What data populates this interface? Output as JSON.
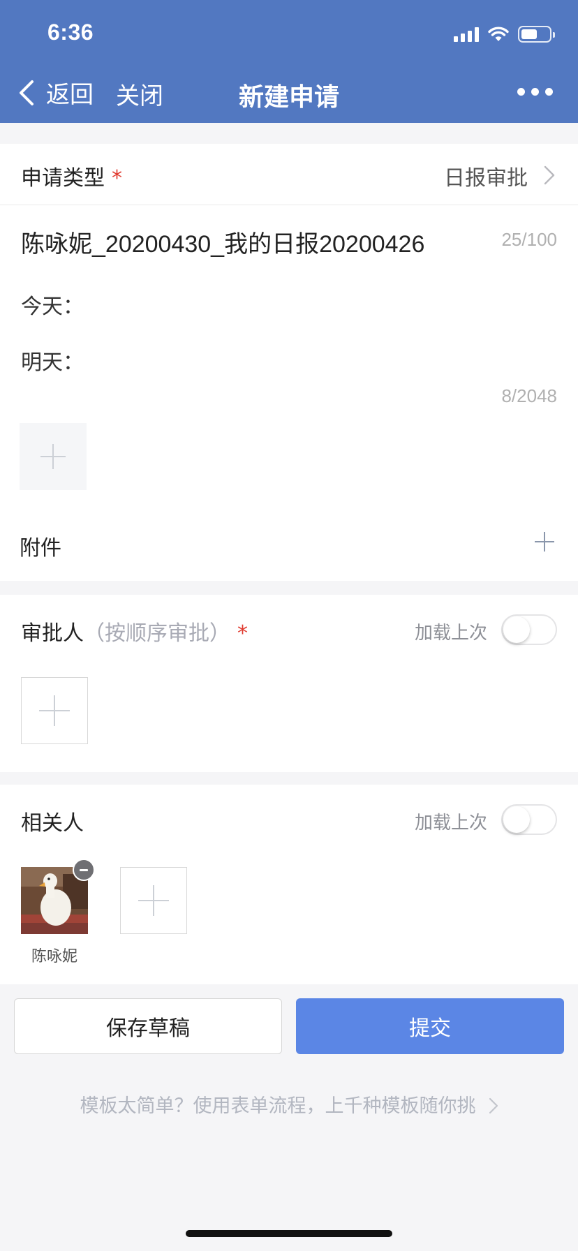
{
  "status_bar": {
    "time": "6:36"
  },
  "nav": {
    "back_label": "返回",
    "close_label": "关闭",
    "title": "新建申请"
  },
  "form": {
    "type_label": "申请类型",
    "required_mark": "*",
    "type_value": "日报审批",
    "title_value": "陈咏妮_20200430_我的日报20200426",
    "title_count": "25/100",
    "body_line1": "今天：",
    "body_line2": "明天：",
    "body_count": "8/2048",
    "attachment_label": "附件"
  },
  "approvers": {
    "label": "审批人",
    "hint": "（按顺序审批）",
    "load_last_label": "加载上次",
    "load_last_on": false
  },
  "cc": {
    "label": "相关人",
    "load_last_label": "加载上次",
    "load_last_on": false,
    "people": [
      {
        "name": "陈咏妮"
      }
    ]
  },
  "actions": {
    "save_draft_label": "保存草稿",
    "submit_label": "提交"
  },
  "footer": {
    "template_link": "模板太简单？使用表单流程，上千种模板随你挑"
  },
  "colors": {
    "header_bg": "#5278c1",
    "submit_bg": "#5b86e5",
    "required": "#e03a2f"
  }
}
